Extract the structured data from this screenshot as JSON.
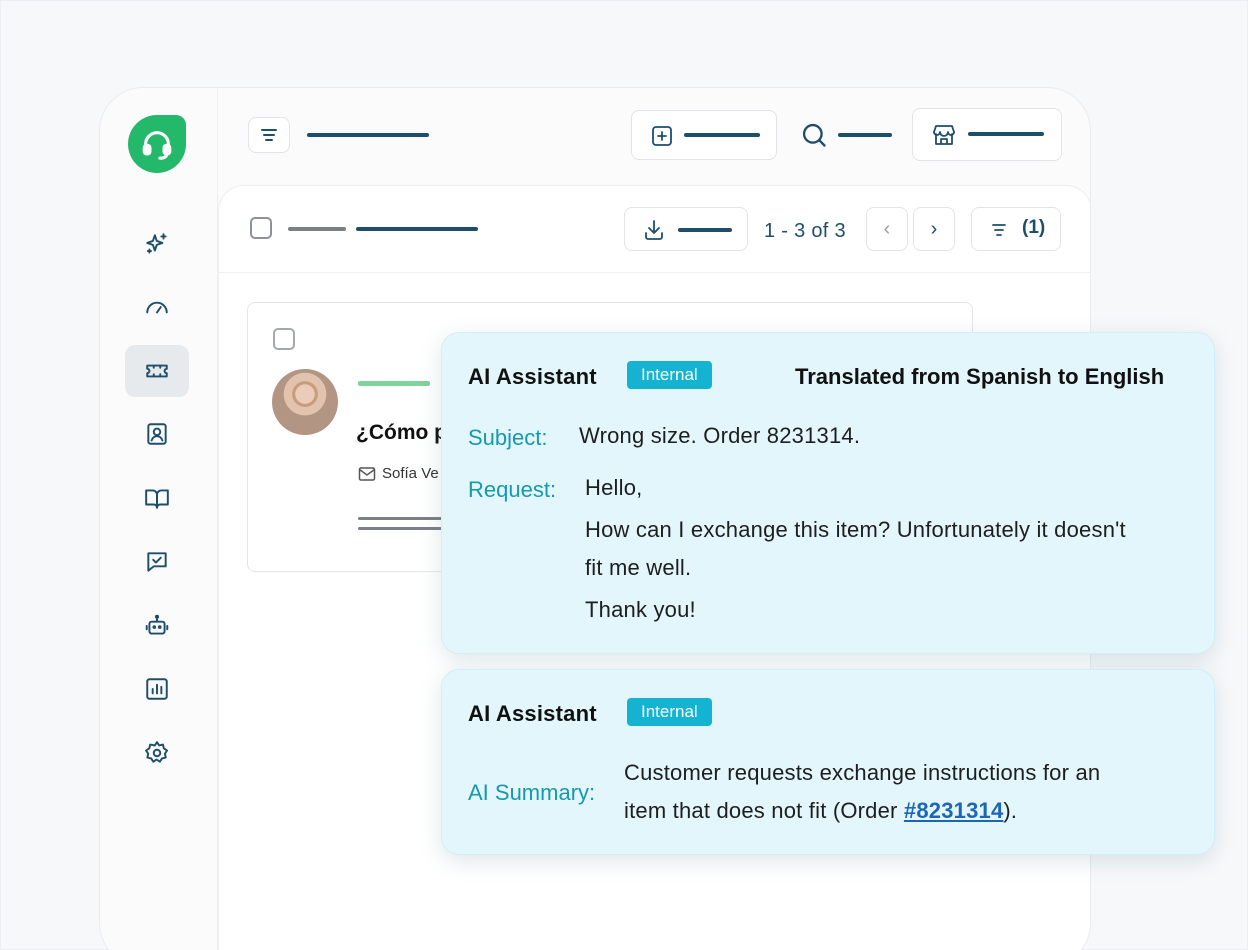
{
  "toolbar": {
    "pagination": "1 - 3 of 3",
    "prev_icon": "‹",
    "next_icon": "›",
    "filter_count": "(1)"
  },
  "ticket": {
    "title": "¿Cómo p",
    "sender": "Sofía Ve"
  },
  "ai_translation_card": {
    "title": "AI Assistant",
    "badge": "Internal",
    "note": "Translated from Spanish to English",
    "subject_label": "Subject:",
    "subject_value": "Wrong size. Order 8231314.",
    "request_label": "Request:",
    "request_lines": [
      "Hello,",
      "How can I exchange this item? Unfortunately it doesn't",
      "fit me well.",
      "Thank you!"
    ]
  },
  "ai_summary_card": {
    "title": "AI Assistant",
    "badge": "Internal",
    "summary_label": "AI Summary:",
    "summary_line1": "Customer requests exchange instructions for an",
    "summary_line2_prefix": "item that does not fit (Order ",
    "order_link": "#8231314",
    "summary_line2_suffix": ")."
  },
  "colors": {
    "brand_green": "#24b86a",
    "navy": "#1d4e6c",
    "badge_cyan": "#15b3d2",
    "label_teal": "#1799ad",
    "card_bg": "#e3f6fc",
    "link_blue": "#1b67b6"
  },
  "icons": {
    "logo": "headset-icon",
    "nav": [
      "sparkles-icon",
      "gauge-icon",
      "ticket-icon",
      "contact-icon",
      "book-icon",
      "chat-check-icon",
      "bot-icon",
      "chart-icon",
      "gear-icon"
    ]
  }
}
